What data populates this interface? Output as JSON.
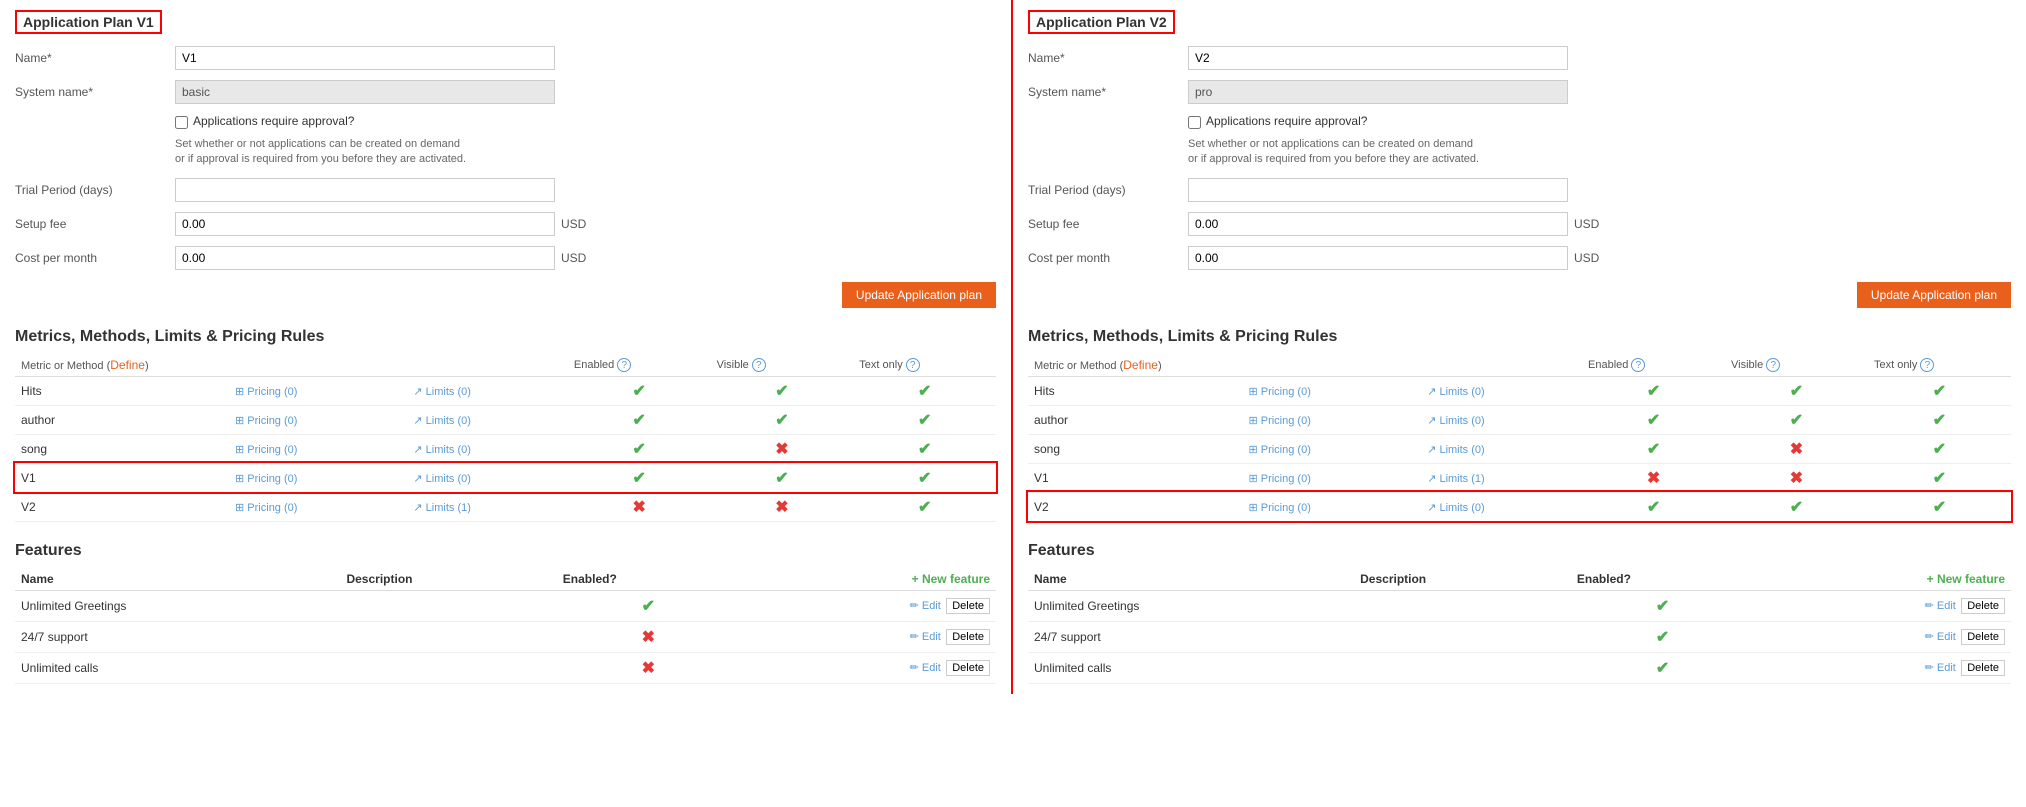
{
  "panels": [
    {
      "id": "v1",
      "title": "Application Plan V1",
      "form": {
        "name_label": "Name*",
        "name_value": "V1",
        "system_name_label": "System name*",
        "system_name_value": "basic",
        "approval_label": "Applications require approval?",
        "approval_hint_line1": "Set whether or not applications can be created on demand",
        "approval_hint_line2": "or if approval is required from you before they are activated.",
        "trial_label": "Trial Period (days)",
        "trial_value": "",
        "setup_fee_label": "Setup fee",
        "setup_fee_value": "0.00",
        "cost_label": "Cost per month",
        "cost_value": "0.00",
        "currency": "USD",
        "update_btn": "Update Application plan"
      },
      "metrics_title": "Metrics, Methods, Limits & Pricing Rules",
      "metrics_col_metric": "Metric or Method",
      "metrics_col_define": "Define",
      "metrics_col_enabled": "Enabled",
      "metrics_col_visible": "Visible",
      "metrics_col_textonly": "Text only",
      "metrics": [
        {
          "name": "Hits",
          "pricing": "Pricing (0)",
          "limits": "Limits (0)",
          "enabled": true,
          "visible": true,
          "textonly": true,
          "highlighted": false
        },
        {
          "name": "author",
          "pricing": "Pricing (0)",
          "limits": "Limits (0)",
          "enabled": true,
          "visible": true,
          "textonly": true,
          "highlighted": false
        },
        {
          "name": "song",
          "pricing": "Pricing (0)",
          "limits": "Limits (0)",
          "enabled": true,
          "visible": false,
          "textonly": true,
          "highlighted": false
        },
        {
          "name": "V1",
          "pricing": "Pricing (0)",
          "limits": "Limits (0)",
          "enabled": true,
          "visible": true,
          "textonly": true,
          "highlighted": true
        },
        {
          "name": "V2",
          "pricing": "Pricing (0)",
          "limits": "Limits (1)",
          "enabled": false,
          "visible": false,
          "textonly": true,
          "highlighted": false
        }
      ],
      "features_title": "Features",
      "features_col_name": "Name",
      "features_col_desc": "Description",
      "features_col_enabled": "Enabled?",
      "new_feature_label": "+ New feature",
      "features": [
        {
          "name": "Unlimited Greetings",
          "description": "",
          "enabled": true
        },
        {
          "name": "24/7 support",
          "description": "",
          "enabled": false
        },
        {
          "name": "Unlimited calls",
          "description": "",
          "enabled": false
        }
      ]
    },
    {
      "id": "v2",
      "title": "Application Plan V2",
      "form": {
        "name_label": "Name*",
        "name_value": "V2",
        "system_name_label": "System name*",
        "system_name_value": "pro",
        "approval_label": "Applications require approval?",
        "approval_hint_line1": "Set whether or not applications can be created on demand",
        "approval_hint_line2": "or if approval is required from you before they are activated.",
        "trial_label": "Trial Period (days)",
        "trial_value": "",
        "setup_fee_label": "Setup fee",
        "setup_fee_value": "0.00",
        "cost_label": "Cost per month",
        "cost_value": "0.00",
        "currency": "USD",
        "update_btn": "Update Application plan"
      },
      "metrics_title": "Metrics, Methods, Limits & Pricing Rules",
      "metrics_col_metric": "Metric or Method",
      "metrics_col_define": "Define",
      "metrics_col_enabled": "Enabled",
      "metrics_col_visible": "Visible",
      "metrics_col_textonly": "Text only",
      "metrics": [
        {
          "name": "Hits",
          "pricing": "Pricing (0)",
          "limits": "Limits (0)",
          "enabled": true,
          "visible": true,
          "textonly": true,
          "highlighted": false
        },
        {
          "name": "author",
          "pricing": "Pricing (0)",
          "limits": "Limits (0)",
          "enabled": true,
          "visible": true,
          "textonly": true,
          "highlighted": false
        },
        {
          "name": "song",
          "pricing": "Pricing (0)",
          "limits": "Limits (0)",
          "enabled": true,
          "visible": false,
          "textonly": true,
          "highlighted": false
        },
        {
          "name": "V1",
          "pricing": "Pricing (0)",
          "limits": "Limits (1)",
          "enabled": false,
          "visible": false,
          "textonly": true,
          "highlighted": false
        },
        {
          "name": "V2",
          "pricing": "Pricing (0)",
          "limits": "Limits (0)",
          "enabled": true,
          "visible": true,
          "textonly": true,
          "highlighted": true
        }
      ],
      "features_title": "Features",
      "features_col_name": "Name",
      "features_col_desc": "Description",
      "features_col_enabled": "Enabled?",
      "new_feature_label": "+ New feature",
      "features": [
        {
          "name": "Unlimited Greetings",
          "description": "",
          "enabled": true
        },
        {
          "name": "24/7 support",
          "description": "",
          "enabled": true
        },
        {
          "name": "Unlimited calls",
          "description": "",
          "enabled": true
        }
      ]
    }
  ]
}
